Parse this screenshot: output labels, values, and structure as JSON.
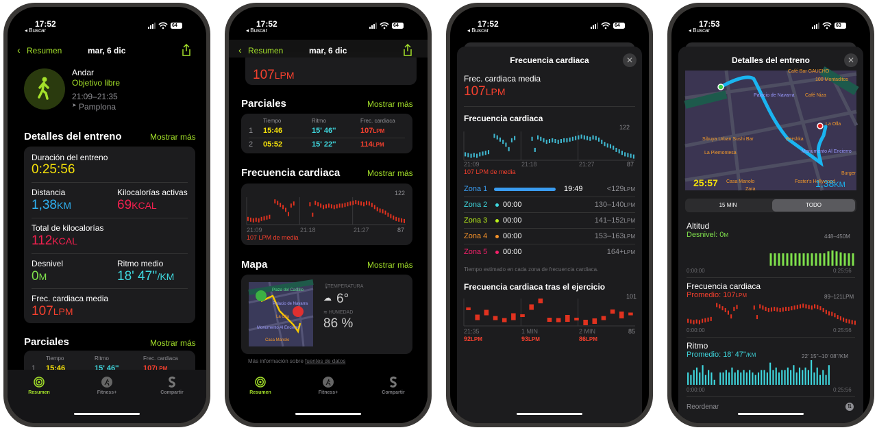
{
  "phones": [
    {
      "status": {
        "time": "17:52",
        "back": "◂ Buscar",
        "battery": "64"
      }
    },
    {
      "status": {
        "time": "17:52",
        "back": "◂ Buscar",
        "battery": "64"
      }
    },
    {
      "status": {
        "time": "17:52",
        "back": "◂ Buscar",
        "battery": "64"
      }
    },
    {
      "status": {
        "time": "17:53",
        "back": "◂ Buscar",
        "battery": "63"
      }
    }
  ],
  "nav": {
    "back": "Resumen",
    "date": "mar, 6 dic"
  },
  "workout": {
    "type": "Andar",
    "goal": "Objetivo libre",
    "time_range": "21:09–21:35",
    "location": "Pamplona"
  },
  "details": {
    "title": "Detalles del entreno",
    "more": "Mostrar más",
    "duration_label": "Duración del entreno",
    "duration": "0:25:56",
    "distance_label": "Distancia",
    "distance": "1,38",
    "distance_unit": "KM",
    "active_kcal_label": "Kilocalorías activas",
    "active_kcal": "69",
    "kcal_unit": "KCAL",
    "total_kcal_label": "Total de kilocalorías",
    "total_kcal": "112",
    "elevation_label": "Desnivel",
    "elevation": "0",
    "elevation_unit": "M",
    "pace_label": "Ritmo medio",
    "pace": "18' 47''",
    "pace_unit": "/KM",
    "hr_label": "Frec. cardiaca media",
    "hr": "107",
    "hr_unit": "LPM"
  },
  "splits": {
    "title": "Parciales",
    "more": "Mostrar más",
    "headers": [
      "Tiempo",
      "Ritmo",
      "Frec. cardiaca"
    ],
    "rows": [
      {
        "n": "1",
        "time": "15:46",
        "pace": "15' 46''",
        "hr": "107",
        "unit": "LPM"
      },
      {
        "n": "2",
        "time": "05:52",
        "pace": "15' 22''",
        "hr": "114",
        "unit": "LPM"
      }
    ]
  },
  "hr_section": {
    "title": "Frecuencia cardiaca",
    "more": "Mostrar más",
    "max": "122",
    "min": "87",
    "ticks": [
      "21:09",
      "21:18",
      "21:27"
    ],
    "avg_note": "107 LPM de media"
  },
  "map_section": {
    "title": "Mapa",
    "more": "Mostrar más",
    "temp_label": "TEMPERATURA",
    "temp": "6°",
    "humidity_label": "HUMEDAD",
    "humidity": "86 %",
    "places": [
      "Plaza del Castillo",
      "Palacio de Navarra",
      "La Olla",
      "Monumento Al Encierro",
      "Casa Manolo"
    ],
    "footer_prefix": "Más información sobre ",
    "footer_link": "fuentes de datos"
  },
  "tabs": [
    {
      "label": "Resumen",
      "icon": "activity-rings-icon"
    },
    {
      "label": "Fitness+",
      "icon": "fitness-plus-icon"
    },
    {
      "label": "Compartir",
      "icon": "sharing-icon"
    }
  ],
  "hr_sheet": {
    "title": "Frecuencia cardiaca",
    "avg_label": "Frec. cardiaca media",
    "avg": "107",
    "unit": "LPM",
    "chart_title": "Frecuencia cardiaca",
    "zones": [
      {
        "name": "Zona 1",
        "time": "19:49",
        "range": "<129",
        "color": "#3a9cf0",
        "fill": 0.95
      },
      {
        "name": "Zona 2",
        "time": "00:00",
        "range": "130–140",
        "color": "#3fd8df",
        "fill": 0
      },
      {
        "name": "Zona 3",
        "time": "00:00",
        "range": "141–152",
        "color": "#b9f01a",
        "fill": 0
      },
      {
        "name": "Zona 4",
        "time": "00:00",
        "range": "153–163",
        "color": "#f5922a",
        "fill": 0
      },
      {
        "name": "Zona 5",
        "time": "00:00",
        "range": "164+",
        "color": "#f5206a",
        "fill": 0
      }
    ],
    "zones_note": "Tiempo estimado en cada zona de frecuencia cardiaca.",
    "recovery_title": "Frecuencia cardiaca tras el ejercicio",
    "recovery_max": "101",
    "recovery_min": "85",
    "recovery_ticks": [
      {
        "label": "21:35",
        "value": "92"
      },
      {
        "label": "1 MIN",
        "value": "93"
      },
      {
        "label": "2 MIN",
        "value": "86"
      }
    ]
  },
  "detail_sheet": {
    "title": "Detalles del entreno",
    "map_time": "25:57",
    "map_distance": "1,38",
    "map_distance_unit": "KM",
    "map_places": [
      "Café Bar GAUCHO",
      "100 Montaditos",
      "Palacio de Navarra",
      "Café Niza",
      "La Olla",
      "Bershka",
      "Sibuya Urban Sushi Bar",
      "La Piemontesa",
      "Monumento Al Encierro",
      "Casa Manolo",
      "Foster's Hollywood",
      "Zara",
      "Burger"
    ],
    "segments": [
      "15 MIN",
      "TODO"
    ],
    "selected_segment": "TODO",
    "altitude": {
      "title": "Altitud",
      "summary": "Desnivel: 0",
      "unit": "M",
      "range": "448–450",
      "start": "0:00:00",
      "end": "0:25:56"
    },
    "hr": {
      "title": "Frecuencia cardiaca",
      "summary": "Promedio: 107",
      "unit": "LPM",
      "range": "89–121",
      "start": "0:00:00",
      "end": "0:25:56"
    },
    "pace": {
      "title": "Ritmo",
      "summary": "Promedio: 18' 47''",
      "unit": "/KM",
      "range": "22' 15''–10' 08''",
      "start": "0:00:00",
      "end": "0:25:56"
    },
    "reorder": "Reordenar"
  },
  "chart_data": [
    {
      "type": "bar",
      "title": "Frecuencia cardiaca",
      "ylim": [
        87,
        122
      ],
      "x": [
        "21:09",
        "21:35"
      ],
      "values": [
        93,
        92,
        91,
        92,
        91,
        93,
        94,
        95,
        96,
        null,
        118,
        116,
        113,
        110,
        106,
        100,
        112,
        115,
        null,
        null,
        null,
        null,
        null,
        114,
        99,
        116,
        114,
        112,
        110,
        111,
        112,
        111,
        110,
        111,
        112,
        112,
        113,
        114,
        115,
        116,
        117,
        116,
        115,
        114,
        116,
        115,
        113,
        110,
        107,
        105,
        104,
        102,
        99,
        97,
        95,
        93,
        92,
        91,
        90
      ]
    },
    {
      "type": "bar",
      "title": "Frecuencia cardiaca tras el ejercicio",
      "ylim": [
        85,
        101
      ],
      "values": [
        95,
        90,
        92,
        90,
        88,
        90,
        91,
        96,
        99,
        89,
        88,
        89,
        89,
        87,
        87,
        90,
        93,
        91,
        92
      ]
    },
    {
      "type": "bar",
      "title": "Altitud",
      "ylim": [
        448,
        450
      ],
      "values": [
        null,
        null,
        null,
        null,
        null,
        null,
        null,
        null,
        null,
        null,
        null,
        null,
        null,
        null,
        null,
        null,
        null,
        null,
        null,
        null,
        449,
        449,
        449,
        449,
        449,
        449,
        449,
        449,
        449,
        449,
        449,
        449,
        449,
        449,
        449.2,
        449.3,
        449.2,
        449.1,
        449,
        449,
        449
      ]
    },
    {
      "type": "bar",
      "title": "Ritmo",
      "values": [
        0.5,
        0.4,
        0.6,
        0.7,
        0.5,
        0.8,
        0.4,
        0.6,
        0.5,
        0.2,
        null,
        0.5,
        0.5,
        0.6,
        0.5,
        0.7,
        0.5,
        0.6,
        0.5,
        0.6,
        0.5,
        0.6,
        0.5,
        0.4,
        0.5,
        0.6,
        0.6,
        0.5,
        0.9,
        0.6,
        0.7,
        0.5,
        0.6,
        0.6,
        0.7,
        0.6,
        0.8,
        0.5,
        0.7,
        0.6,
        0.7,
        0.6,
        1.0,
        0.5,
        0.7,
        0.4,
        0.6,
        0.4,
        0.8
      ]
    }
  ]
}
